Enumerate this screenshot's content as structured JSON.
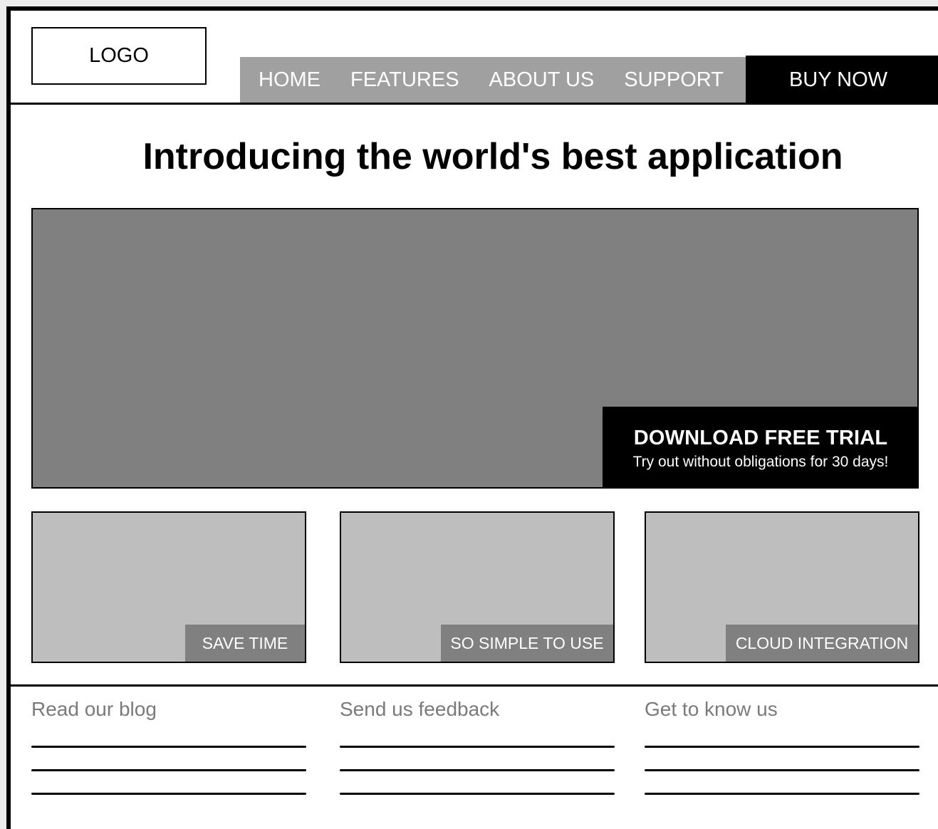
{
  "header": {
    "logo_text": "LOGO",
    "nav_items": [
      "HOME",
      "FEATURES",
      "ABOUT US",
      "SUPPORT"
    ],
    "buy_now_label": "BUY NOW"
  },
  "hero": {
    "headline": "Introducing the world's best application",
    "cta_title": "DOWNLOAD FREE TRIAL",
    "cta_subtitle": "Try out without obligations for 30 days!"
  },
  "features": [
    {
      "label": "SAVE TIME"
    },
    {
      "label": "SO SIMPLE TO USE"
    },
    {
      "label": "CLOUD INTEGRATION"
    }
  ],
  "footer": {
    "columns": [
      {
        "heading": "Read our blog"
      },
      {
        "heading": "Send us feedback"
      },
      {
        "heading": "Get to know us"
      }
    ]
  },
  "colors": {
    "nav_background": "#a0a0a0",
    "hero_placeholder": "#808080",
    "feature_placeholder": "#bebebe",
    "footer_heading": "#7a7a7a",
    "accent": "#000000"
  }
}
